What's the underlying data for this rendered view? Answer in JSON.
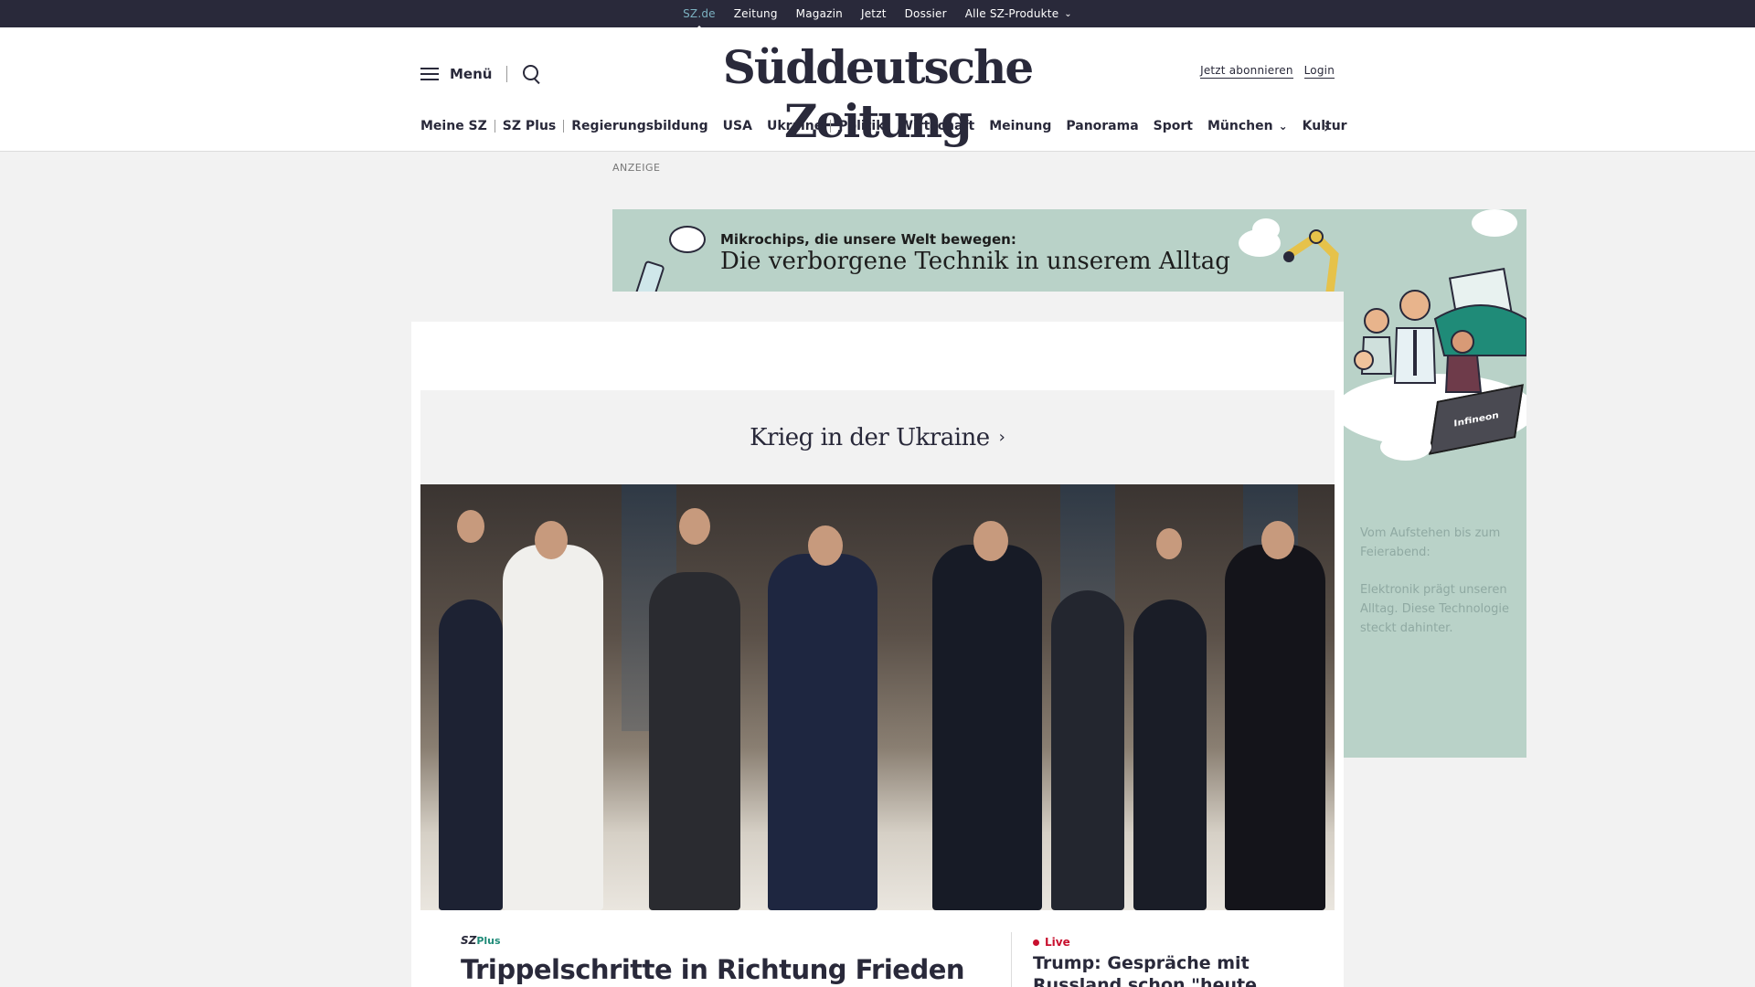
{
  "topbar": {
    "links": [
      "SZ.de",
      "Zeitung",
      "Magazin",
      "Jetzt",
      "Dossier",
      "Alle SZ-Produkte"
    ]
  },
  "header": {
    "menu_label": "Menü",
    "logo_text": "Süddeutsche Zeitung",
    "subscribe_label": "Jetzt abonnieren",
    "login_label": "Login"
  },
  "nav": {
    "items": [
      "Meine SZ",
      "SZ Plus",
      "Regierungsbildung",
      "USA",
      "Ukraine",
      "Politik",
      "Wirtschaft",
      "Meinung",
      "Panorama",
      "Sport",
      "München",
      "Kultur"
    ]
  },
  "ad": {
    "label": "ANZEIGE",
    "kicker": "Mikrochips, die unsere Welt bewegen:",
    "title": "Die verborgene Technik in unserem Alltag",
    "chip_brand": "Infineon",
    "sky_text_1": "Vom Aufstehen bis zum Feierabend:",
    "sky_text_2": "Elektronik prägt unseren Alltag. Diese Technologie steckt dahinter."
  },
  "dossier": {
    "title": "Krieg in der Ukraine"
  },
  "lead_story": {
    "badge_sz": "SZ",
    "badge_plus": "Plus",
    "headline": "Trippelschritte in Richtung Frieden"
  },
  "live_story": {
    "label": "Live",
    "headline": "Trump: Gespräche mit Russland schon \"heute und"
  },
  "colors": {
    "brand_dark": "#29293a",
    "active_link": "#7cb1c1",
    "plus_green": "#1f8b78",
    "live_red": "#c8102e",
    "ad_green": "#b9d2c8"
  }
}
